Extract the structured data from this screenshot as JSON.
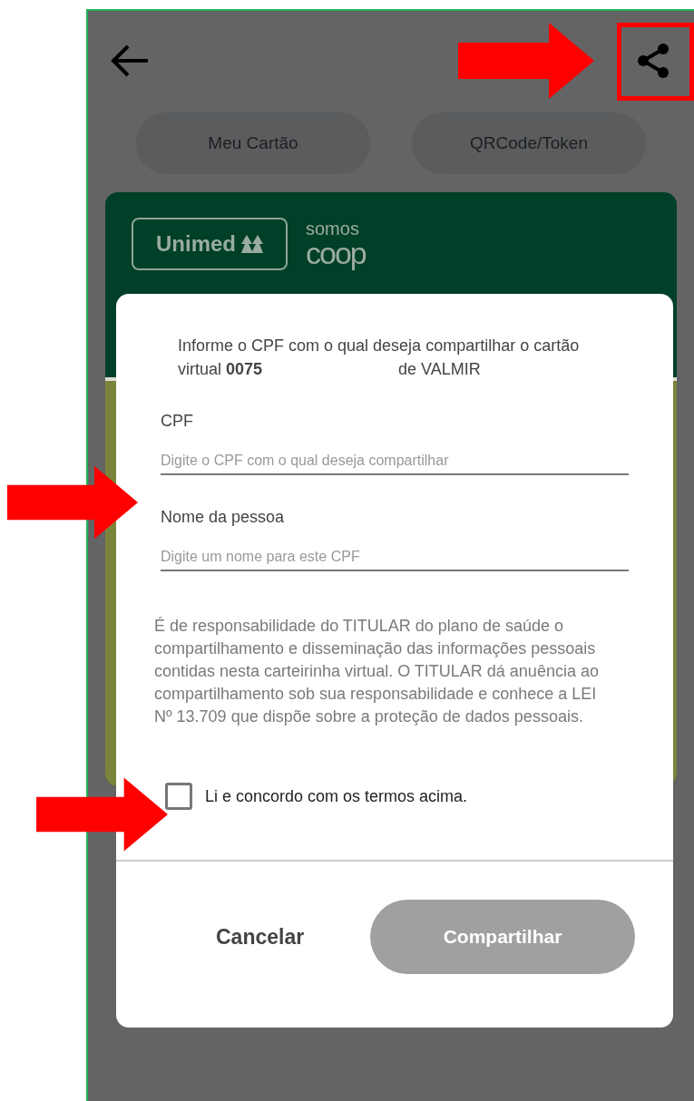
{
  "tabs": [
    {
      "label": "Meu Cartão"
    },
    {
      "label": "QRCode/Token"
    }
  ],
  "card": {
    "brand": "Unimed",
    "coop_top": "somos",
    "coop_bottom": "coop"
  },
  "dialog": {
    "intro": "Informe o CPF com o qual deseja compartilhar o cartão virtual **0075**",
    "intro_end": "de VALMIR",
    "fields": [
      {
        "label": "CPF",
        "placeholder": "Digite o CPF com o qual deseja compartilhar"
      },
      {
        "label": "Nome da pessoa",
        "placeholder": "Digite um nome para este CPF"
      }
    ],
    "disclaimer": "É de responsabilidade do TITULAR do plano de saúde o compartilhamento e disseminação das informações pessoais contidas nesta carteirinha virtual. O TITULAR dá anuência ao compartilhamento sob sua responsabilidade e conhece a LEI Nº 13.709 que dispõe sobre a proteção de dados pessoais.",
    "agree": {
      "label": "Li e concordo com os termos acima.",
      "checked": false
    },
    "cancel": "Cancelar",
    "share": {
      "label": "Compartilhar",
      "disabled": true
    }
  }
}
